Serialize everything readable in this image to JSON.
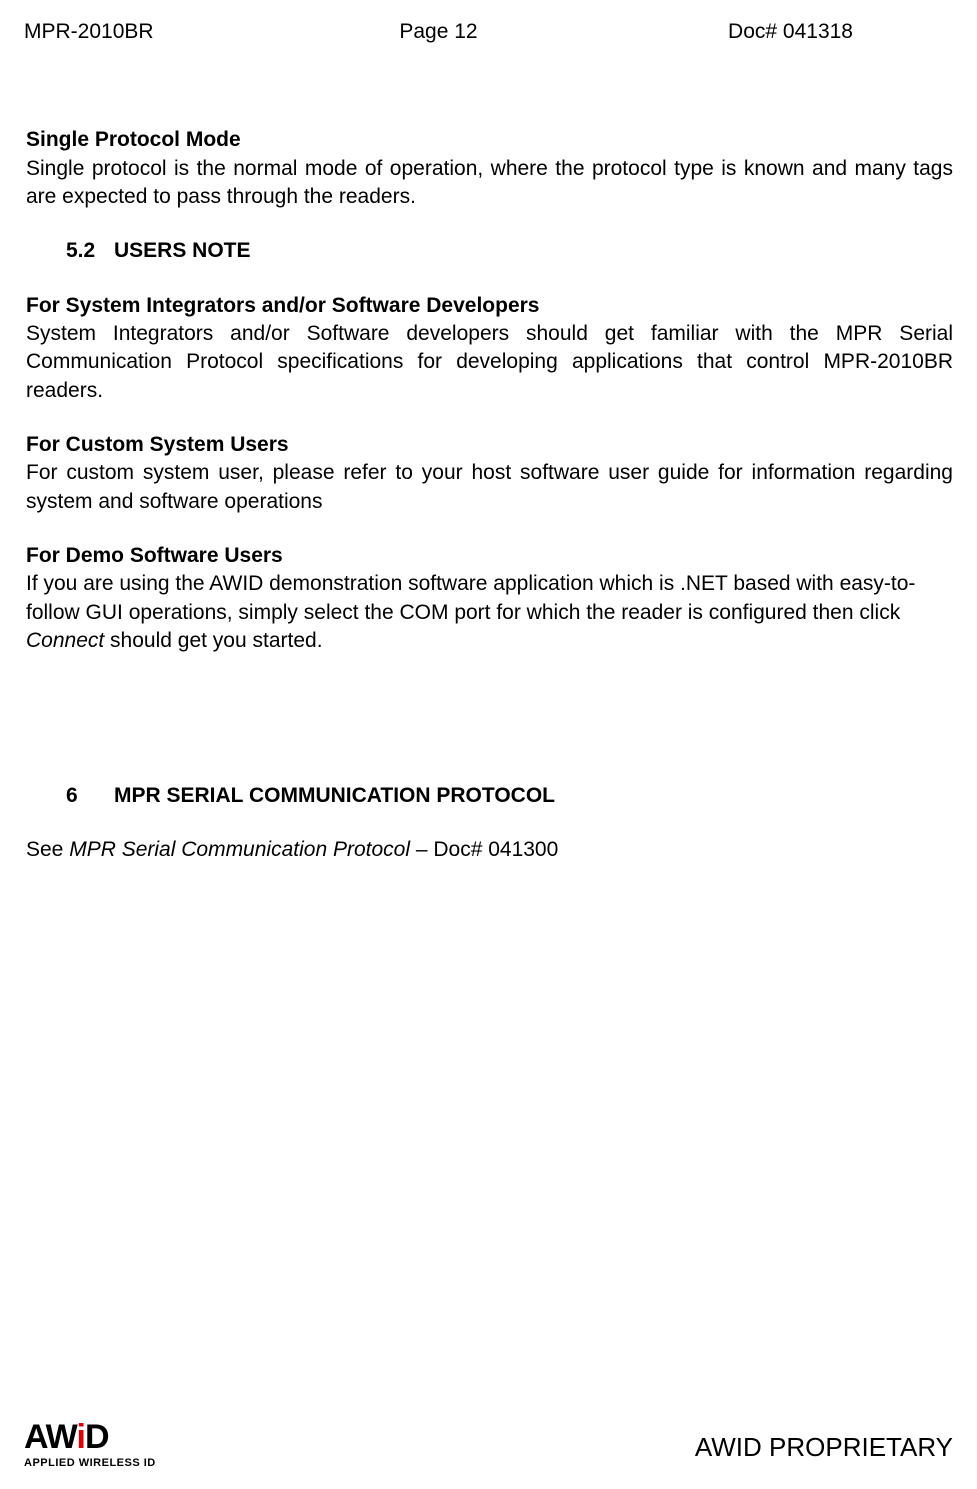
{
  "header": {
    "left": "MPR-2010BR",
    "center": "Page 12",
    "right": "Doc# 041318"
  },
  "content": {
    "h_single_protocol": "Single Protocol Mode",
    "p_single_protocol": "Single protocol is the normal mode of operation, where the protocol type is known and many tags are expected to pass through the readers.",
    "sec_5_2_num": "5.2",
    "sec_5_2_title": "USERS NOTE",
    "h_sys_integ": "For System Integrators and/or Software Developers",
    "p_sys_integ": "System Integrators and/or Software developers should get familiar with the MPR Serial Communication Protocol specifications for developing applications that control MPR-2010BR readers.",
    "h_custom": "For Custom System Users",
    "p_custom": "For custom system user, please refer to your host software user guide for information regarding system and software operations",
    "h_demo": "For Demo Software Users",
    "p_demo_1": "If you are using the AWID demonstration software application which is .NET based with easy-to-follow GUI operations, simply select the COM port for which the reader is configured then click ",
    "p_demo_italic": "Connect",
    "p_demo_2": " should get you started.",
    "sec_6_num": "6",
    "sec_6_title": "MPR SERIAL COMMUNICATION PROTOCOL",
    "p_see_1": "See ",
    "p_see_italic": "MPR Serial Communication Protocol",
    "p_see_2": " – Doc# 041300"
  },
  "footer": {
    "logo_main_pre": "AW",
    "logo_main_i": "i",
    "logo_main_post": "D",
    "logo_sub": "APPLIED WIRELESS ID",
    "right": "AWID PROPRIETARY"
  }
}
